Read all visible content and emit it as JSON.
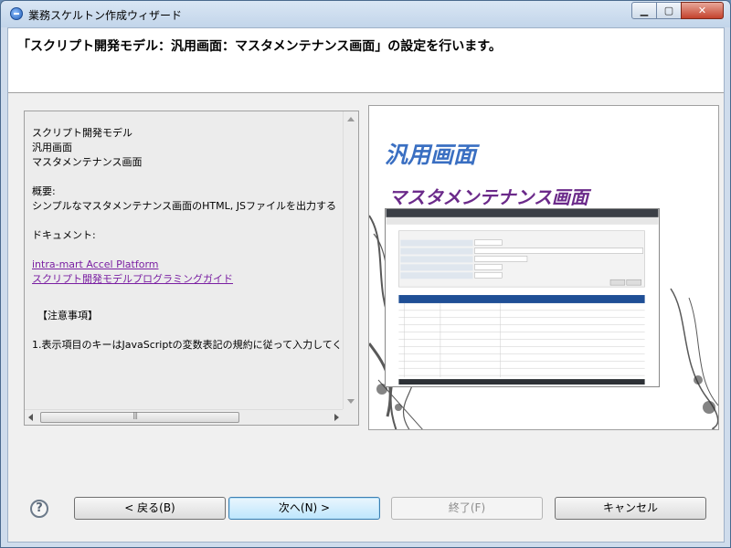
{
  "window": {
    "title": "業務スケルトン作成ウィザード"
  },
  "header": {
    "title": "「スクリプト開発モデル：汎用画面：マスタメンテナンス画面」の設定を行います。"
  },
  "description": {
    "line1": "スクリプト開発モデル",
    "line2": "汎用画面",
    "line3": "マスタメンテナンス画面",
    "overview_label": "概要:",
    "overview_text": "シンプルなマスタメンテナンス画面のHTML, JSファイルを出力する",
    "document_label": "ドキュメント:",
    "link1": "intra-mart Accel Platform",
    "link2": "スクリプト開発モデルプログラミングガイド",
    "notes_label": "【注意事項】",
    "notes_text": "1.表示項目のキーはJavaScriptの変数表記の規約に従って入力してく"
  },
  "preview": {
    "title1": "汎用画面",
    "title2": "マスタメンテナンス画面"
  },
  "buttons": {
    "back": "< 戻る(B)",
    "next": "次へ(N) >",
    "finish": "終了(F)",
    "cancel": "キャンセル"
  },
  "colors": {
    "accent_blue": "#3a6fc2",
    "accent_purple": "#6b2a8a",
    "link": "#7a1fa2"
  }
}
